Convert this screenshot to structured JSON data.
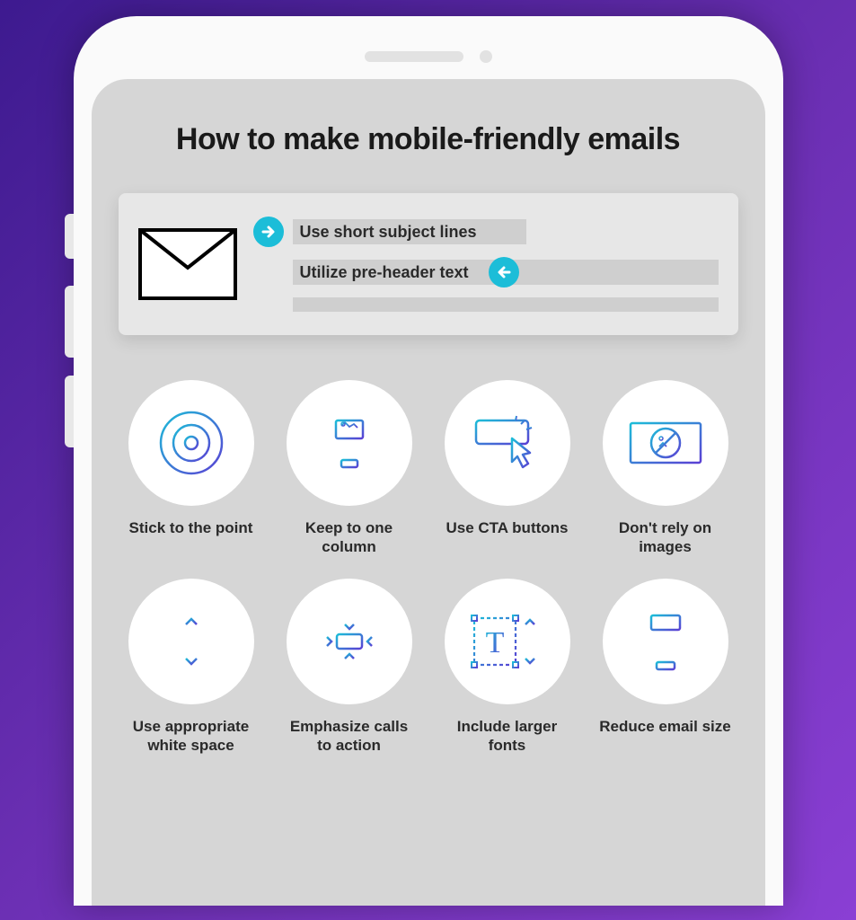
{
  "title": "How to make mobile-friendly emails",
  "email_preview": {
    "subject_label": "Use short subject lines",
    "preheader_label": "Utilize pre-header text"
  },
  "tips": [
    {
      "icon": "target-icon",
      "label": "Stick to the point"
    },
    {
      "icon": "column-icon",
      "label": "Keep to one column"
    },
    {
      "icon": "cta-icon",
      "label": "Use CTA buttons"
    },
    {
      "icon": "no-images-icon",
      "label": "Don't rely on images"
    },
    {
      "icon": "whitespace-icon",
      "label": "Use appropriate white space"
    },
    {
      "icon": "emphasize-icon",
      "label": "Emphasize calls to action"
    },
    {
      "icon": "fonts-icon",
      "label": "Include larger fonts"
    },
    {
      "icon": "reduce-icon",
      "label": "Reduce email size"
    }
  ]
}
